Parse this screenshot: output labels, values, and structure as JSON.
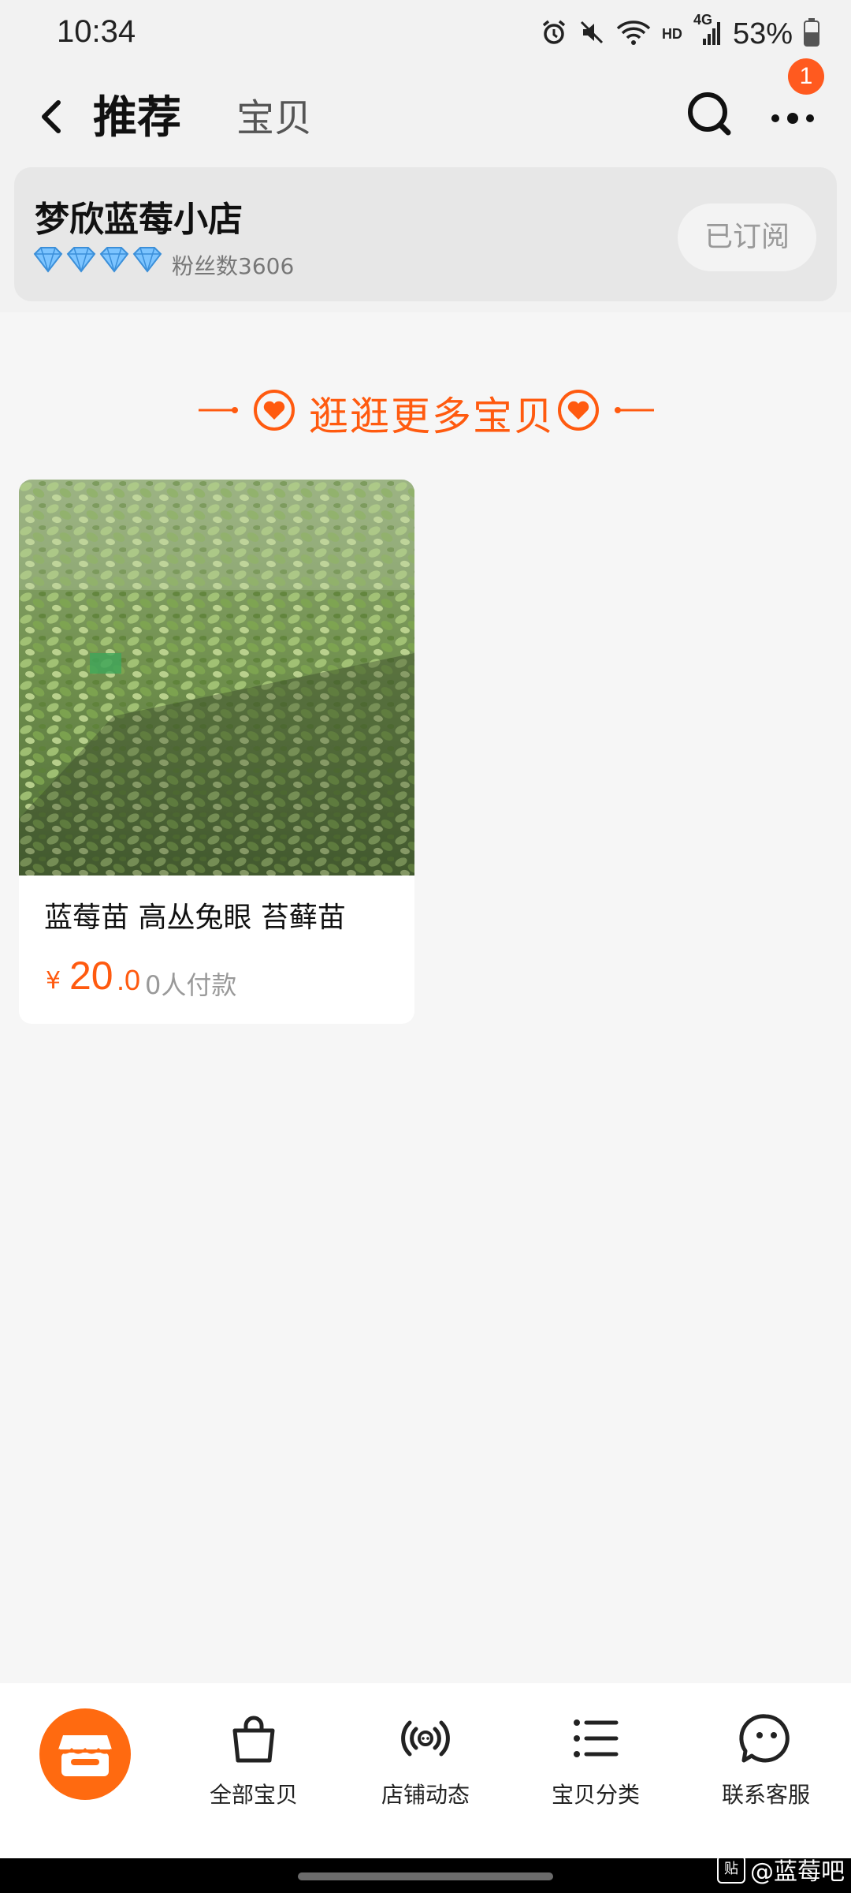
{
  "status_bar": {
    "time": "10:34",
    "hd": "HD",
    "network": "4G",
    "battery": "53%"
  },
  "nav": {
    "tab_recommend": "推荐",
    "tab_items": "宝贝",
    "notification_count": "1"
  },
  "shop": {
    "name": "梦欣蓝莓小店",
    "fans": "粉丝数3606",
    "subscribe_label": "已订阅"
  },
  "section": {
    "title": "逛逛更多宝贝"
  },
  "product": {
    "title": "蓝莓苗 高丛兔眼 苔藓苗",
    "currency": "¥",
    "price_int": "20",
    "price_dec": ".0",
    "buyers": "0人付款"
  },
  "bottom_tabs": [
    {
      "label": "全部宝贝",
      "icon": "bag-icon"
    },
    {
      "label": "店铺动态",
      "icon": "broadcast-icon"
    },
    {
      "label": "宝贝分类",
      "icon": "list-icon"
    },
    {
      "label": "联系客服",
      "icon": "chat-face-icon"
    }
  ],
  "watermark": "@蓝莓吧",
  "colors": {
    "accent": "#ff5a0f",
    "background": "#f6f6f6",
    "card": "#ffffff"
  }
}
